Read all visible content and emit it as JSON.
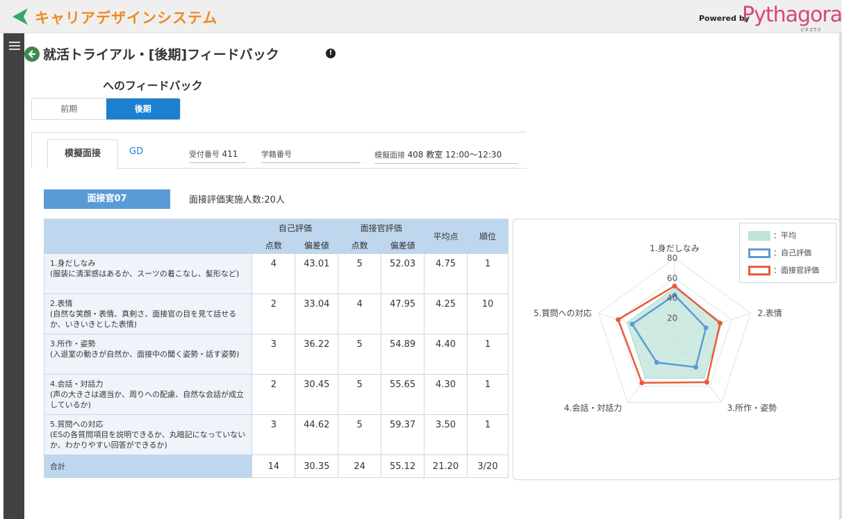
{
  "app": {
    "title": "キャリアデザインシステム",
    "powered_by": "Powered by",
    "brand": "Pythagoras",
    "brand_sub": "ピタゴラス"
  },
  "header": {
    "page_title": "就活トライアル・[後期]フィードバック",
    "subtitle": "へのフィードバック"
  },
  "segment": {
    "first": "前期",
    "second": "後期",
    "selected": "後期"
  },
  "tabs": {
    "active": "模擬面接",
    "other": "GD"
  },
  "meta": {
    "reception_label": "受付番号",
    "reception_value": "411",
    "student_label": "学籍番号",
    "student_value": "",
    "mock_label": "模擬面接",
    "mock_value": "408 教室 12:00～12:30"
  },
  "interviewer": "面接官07",
  "participants": "面接評価実施人数:20人",
  "table": {
    "group_self": "自己評価",
    "group_interviewer": "面接官評価",
    "col_score": "点数",
    "col_deviation": "偏差値",
    "col_average": "平均点",
    "col_rank": "順位",
    "rows": [
      {
        "title": "1.身だしなみ",
        "desc": "(服装に清潔感はあるか、スーツの着こなし、髪形など)",
        "self_score": "4",
        "self_dev": "43.01",
        "int_score": "5",
        "int_dev": "52.03",
        "avg": "4.75",
        "rank": "1"
      },
      {
        "title": "2.表情",
        "desc": "(自然な笑顔・表情、真剣さ、面接官の目を見て話せるか、いきいきとした表情)",
        "self_score": "2",
        "self_dev": "33.04",
        "int_score": "4",
        "int_dev": "47.95",
        "avg": "4.25",
        "rank": "10"
      },
      {
        "title": "3.所作・姿勢",
        "desc": "(入退室の動きが自然か、面接中の聞く姿勢・話す姿勢)",
        "self_score": "3",
        "self_dev": "36.22",
        "int_score": "5",
        "int_dev": "54.89",
        "avg": "4.40",
        "rank": "1"
      },
      {
        "title": "4.会話・対話力",
        "desc": "(声の大きさは適当か、周りへの配慮、自然な会話が成立しているか)",
        "self_score": "2",
        "self_dev": "30.45",
        "int_score": "5",
        "int_dev": "55.65",
        "avg": "4.30",
        "rank": "1"
      },
      {
        "title": "5.質問への対応",
        "desc": "(ESの各質問項目を説明できるか、丸暗記になっていないか、わかりやすい回答ができるか)",
        "self_score": "3",
        "self_dev": "44.62",
        "int_score": "5",
        "int_dev": "59.37",
        "avg": "3.50",
        "rank": "1"
      }
    ],
    "total": {
      "label": "合計",
      "self_score": "14",
      "self_dev": "30.35",
      "int_score": "24",
      "int_dev": "55.12",
      "avg": "21.20",
      "rank": "3/20"
    }
  },
  "chart_data": {
    "type": "radar",
    "categories": [
      "1.身だしなみ",
      "2.表情",
      "3.所作・姿勢",
      "4.会話・対話力",
      "5.質問への対応"
    ],
    "ticks": [
      "20",
      "40",
      "60",
      "80"
    ],
    "range": [
      0,
      80
    ],
    "series": [
      {
        "name": "：平均",
        "values": [
          50,
          50,
          50,
          50,
          50
        ],
        "color": "#bfe3d8"
      },
      {
        "name": "：自己評価",
        "values": [
          43.01,
          33.04,
          36.22,
          30.45,
          44.62
        ],
        "color": "#5b9bd5"
      },
      {
        "name": "：面接官評価",
        "values": [
          52.03,
          47.95,
          54.89,
          55.65,
          59.37
        ],
        "color": "#e85a3c"
      }
    ],
    "legend_position": "top-right"
  }
}
